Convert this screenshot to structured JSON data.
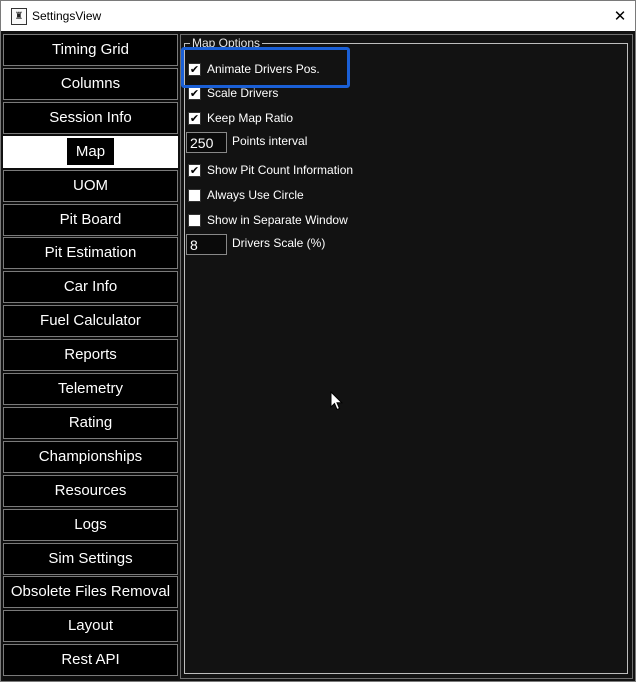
{
  "window": {
    "title": "SettingsView"
  },
  "sidebar": {
    "items": [
      {
        "label": "Timing Grid"
      },
      {
        "label": "Columns"
      },
      {
        "label": "Session Info"
      },
      {
        "label": "Map",
        "active": true
      },
      {
        "label": "UOM"
      },
      {
        "label": "Pit Board"
      },
      {
        "label": "Pit Estimation"
      },
      {
        "label": "Car Info"
      },
      {
        "label": "Fuel Calculator"
      },
      {
        "label": "Reports"
      },
      {
        "label": "Telemetry"
      },
      {
        "label": "Rating"
      },
      {
        "label": "Championships"
      },
      {
        "label": "Resources"
      },
      {
        "label": "Logs"
      },
      {
        "label": "Sim Settings"
      },
      {
        "label": "Obsolete Files Removal"
      },
      {
        "label": "Layout"
      },
      {
        "label": "Rest API"
      }
    ]
  },
  "map_options": {
    "legend": "Map Options",
    "animate_drivers": {
      "label": "Animate Drivers Pos.",
      "checked": true
    },
    "scale_drivers": {
      "label": "Scale Drivers",
      "checked": true
    },
    "keep_map_ratio": {
      "label": "Keep Map Ratio",
      "checked": true
    },
    "points_interval": {
      "value": "250",
      "label": "Points interval"
    },
    "show_pit_count": {
      "label": "Show Pit Count Information",
      "checked": true
    },
    "always_use_circle": {
      "label": "Always Use Circle",
      "checked": false
    },
    "separate_window": {
      "label": "Show in Separate Window",
      "checked": false
    },
    "drivers_scale": {
      "value": "8",
      "label": "Drivers Scale (%)"
    }
  },
  "colors": {
    "highlight": "#1a5fd6",
    "background": "#121212"
  }
}
